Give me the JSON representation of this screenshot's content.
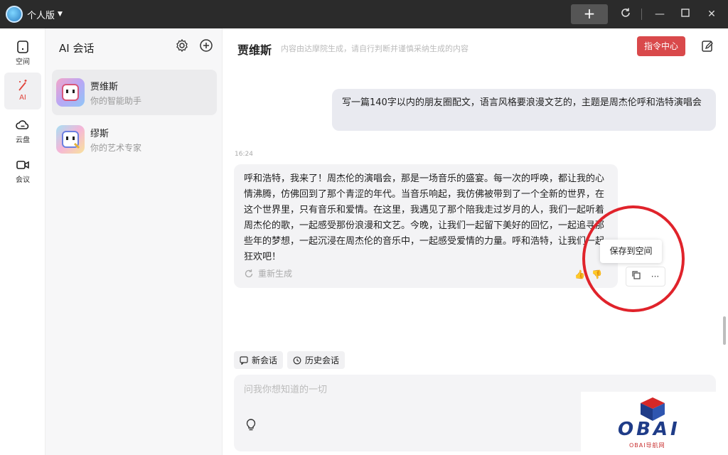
{
  "titlebar": {
    "title": "个人版"
  },
  "rail": {
    "items": [
      {
        "label": "空间",
        "icon": "space-icon"
      },
      {
        "label": "AI",
        "icon": "magic-wand-icon"
      },
      {
        "label": "云盘",
        "icon": "cloud-icon"
      },
      {
        "label": "会议",
        "icon": "video-icon"
      }
    ]
  },
  "convlist": {
    "title": "AI 会话",
    "bots": [
      {
        "name": "贾维斯",
        "desc": "你的智能助手"
      },
      {
        "name": "缪斯",
        "desc": "你的艺术专家"
      }
    ]
  },
  "main": {
    "bot_name": "贾维斯",
    "disclaimer": "内容由达摩院生成，请自行判断并谨慎采纳生成的内容",
    "command_center": "指令中心",
    "user_message": "写一篇140字以内的朋友圈配文，语言风格要浪漫文艺的，主题是周杰伦呼和浩特演唱会",
    "timestamp": "16:24",
    "bot_reply": "呼和浩特，我来了！周杰伦的演唱会，那是一场音乐的盛宴。每一次的呼唤，都让我的心情沸腾，仿佛回到了那个青涩的年代。当音乐响起，我仿佛被带到了一个全新的世界，在这个世界里，只有音乐和爱情。在这里，我遇见了那个陪我走过岁月的人，我们一起听着周杰伦的歌，一起感受那份浪漫和文艺。今晚，让我们一起留下美好的回忆，一起追寻那些年的梦想，一起沉浸在周杰伦的音乐中，一起感受爱情的力量。呼和浩特，让我们一起狂欢吧！",
    "regenerate": "重新生成",
    "tooltip": "保存到空间",
    "chip_new": "新会话",
    "chip_history": "历史会话",
    "input_placeholder": "问我你想知道的一切"
  },
  "watermark": {
    "text": "OBAI",
    "sub": "OBAI导航网"
  },
  "colors": {
    "accent": "#d9494b",
    "titlebar": "#2b2b2b",
    "highlight_circle": "#e0232b"
  }
}
